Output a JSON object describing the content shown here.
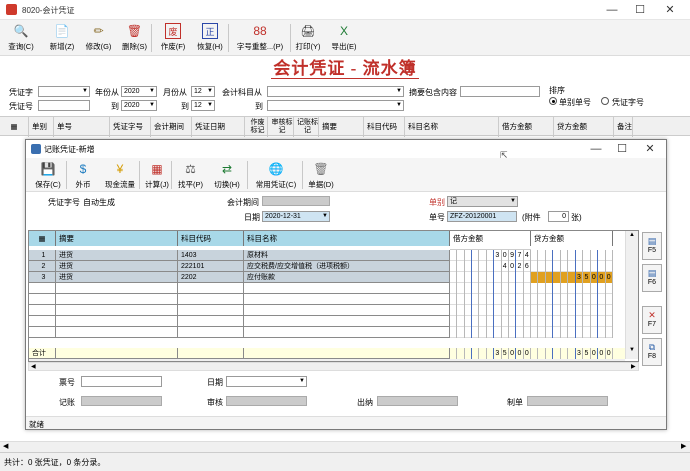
{
  "window": {
    "title": "8020-会计凭证"
  },
  "toolbar": [
    {
      "label": "查询(C)",
      "icon": "🔍",
      "name": "query-button"
    },
    {
      "label": "新增(Z)",
      "icon": "📄",
      "name": "add-button"
    },
    {
      "label": "修改(G)",
      "icon": "✏",
      "name": "edit-button"
    },
    {
      "label": "删除(S)",
      "icon": "🗑",
      "name": "delete-button"
    },
    {
      "label": "作废(F)",
      "icon": "废",
      "name": "void-button"
    },
    {
      "label": "恢复(H)",
      "icon": "正",
      "name": "restore-button"
    },
    {
      "label": "字号重整...(P)",
      "icon": "88",
      "name": "renumber-button"
    },
    {
      "label": "打印(Y)",
      "icon": "🖨",
      "name": "print-button"
    },
    {
      "label": "导出(E)",
      "icon": "X",
      "name": "export-button"
    }
  ],
  "heading": "会计凭证 - 流水簿",
  "filters": {
    "voucher_word_label": "凭证字",
    "year_from_label": "年份从",
    "year_from": "2020",
    "month_from_label": "月份从",
    "month_from": "12",
    "account_from_label": "会计科目从",
    "summary_contains_label": "摘要包含内容",
    "voucher_no_label": "凭证号",
    "to_label": "到",
    "year_to": "2020",
    "month_to": "12",
    "sort_label": "排序",
    "sort_option_1": "单别单号",
    "sort_option_2": "凭证字号"
  },
  "main_columns": [
    "单别",
    "单号",
    "凭证字号",
    "会计期间",
    "凭证日期",
    "作废标记",
    "审核标记",
    "记账标记",
    "摘要",
    "科目代码",
    "科目名称",
    "借方金额",
    "贷方金额",
    "备注"
  ],
  "status_bar": "共计：0 张凭证，0 条分录。",
  "dialog": {
    "title": "记账凭证-新增",
    "toolbar": [
      {
        "label": "保存(C)",
        "icon": "💾",
        "name": "save-button"
      },
      {
        "label": "外币",
        "icon": "$",
        "name": "foreign-currency-button"
      },
      {
        "label": "现金流量",
        "icon": "¥",
        "name": "cash-flow-button"
      },
      {
        "label": "计算(J)",
        "icon": "▦",
        "name": "calculate-button"
      },
      {
        "label": "找平(P)",
        "icon": "⚖",
        "name": "balance-button"
      },
      {
        "label": "切换(H)",
        "icon": "⇄",
        "name": "switch-button"
      },
      {
        "label": "常用凭证(C)",
        "icon": "🌐",
        "name": "common-voucher-button"
      },
      {
        "label": "单据(D)",
        "icon": "🗑",
        "name": "document-button"
      }
    ],
    "voucher_word_label": "凭证字号",
    "voucher_word_value": "自动生成",
    "period_label": "会计期间",
    "date_label": "日期",
    "date_value": "2020-12-31",
    "doc_type_label": "单别",
    "doc_type_value": "记",
    "doc_no_label": "单号",
    "doc_no_value": "ZFZ-20120001",
    "attach_label": "(附件",
    "attach_value": "0",
    "attach_unit": "张)",
    "grid_columns": {
      "summary": "摘要",
      "code": "科目代码",
      "name": "科目名称",
      "debit": "借方金额",
      "credit": "贷方金额"
    },
    "rows": [
      {
        "no": "1",
        "summary": "进货",
        "code": "1403",
        "name": "原材料",
        "debit": "30974",
        "credit": ""
      },
      {
        "no": "2",
        "summary": "进货",
        "code": "222101",
        "name": "应交税费/应交增值税（进项税额）",
        "debit": "4026",
        "credit": ""
      },
      {
        "no": "3",
        "summary": "进货",
        "code": "2202",
        "name": "应付账款",
        "debit": "",
        "credit": "35000"
      }
    ],
    "total_label": "合计",
    "total_debit": "35000",
    "total_credit": "35000",
    "side_buttons": [
      {
        "label": "F5",
        "icon": "▤",
        "name": "f5-button"
      },
      {
        "label": "F6",
        "icon": "▤",
        "name": "f6-button"
      },
      {
        "label": "F7",
        "icon": "✕",
        "name": "f7-button"
      },
      {
        "label": "F8",
        "icon": "⧉",
        "name": "f8-button"
      }
    ],
    "footer": {
      "ticket_no_label": "票号",
      "date_label": "日期",
      "bookkeeper_label": "记账",
      "auditor_label": "审核",
      "cashier_label": "出纳",
      "maker_label": "制单"
    },
    "status": "就绪"
  }
}
